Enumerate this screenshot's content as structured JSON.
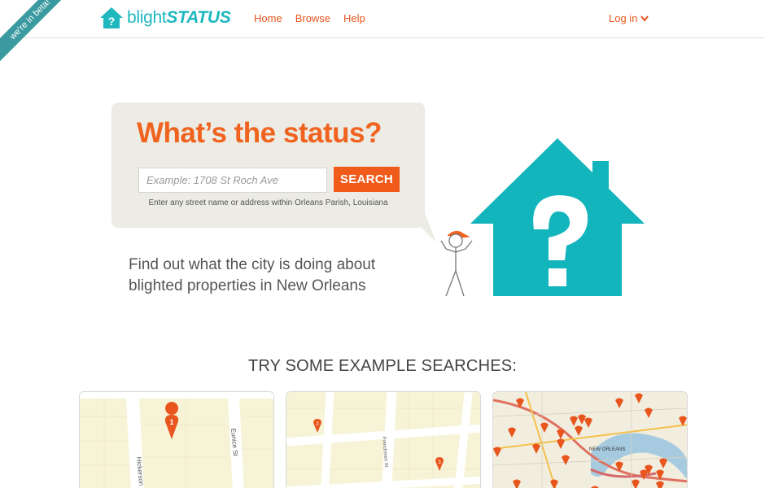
{
  "header": {
    "beta_ribbon": "we're in beta!",
    "logo_light": "blight",
    "logo_bold": "STATUS",
    "nav": [
      "Home",
      "Browse",
      "Help"
    ],
    "login_label": "Log in"
  },
  "hero": {
    "title": "What’s the status?",
    "search_placeholder": "Example: 1708 St Roch Ave",
    "search_button": "SEARCH",
    "hint": "Enter any street name or address within Orleans Parish, Louisiana",
    "tagline_line1": "Find out what the city is doing about",
    "tagline_line2": "blighted properties in New Orleans"
  },
  "examples": {
    "title": "TRY SOME EXAMPLE SEARCHES:",
    "card1": {
      "street_a": "Hickerson St",
      "street_b": "Eunice St",
      "pin": "1"
    },
    "card2": {
      "street_a": "Frenchmen St",
      "pin_a": "2",
      "pin_b": "3"
    },
    "card3": {
      "city_label": "NEW ORLEANS"
    }
  },
  "colors": {
    "brand_teal": "#1fb8bf",
    "accent_orange": "#f0631f",
    "bubble_bg": "#ecebe4"
  }
}
